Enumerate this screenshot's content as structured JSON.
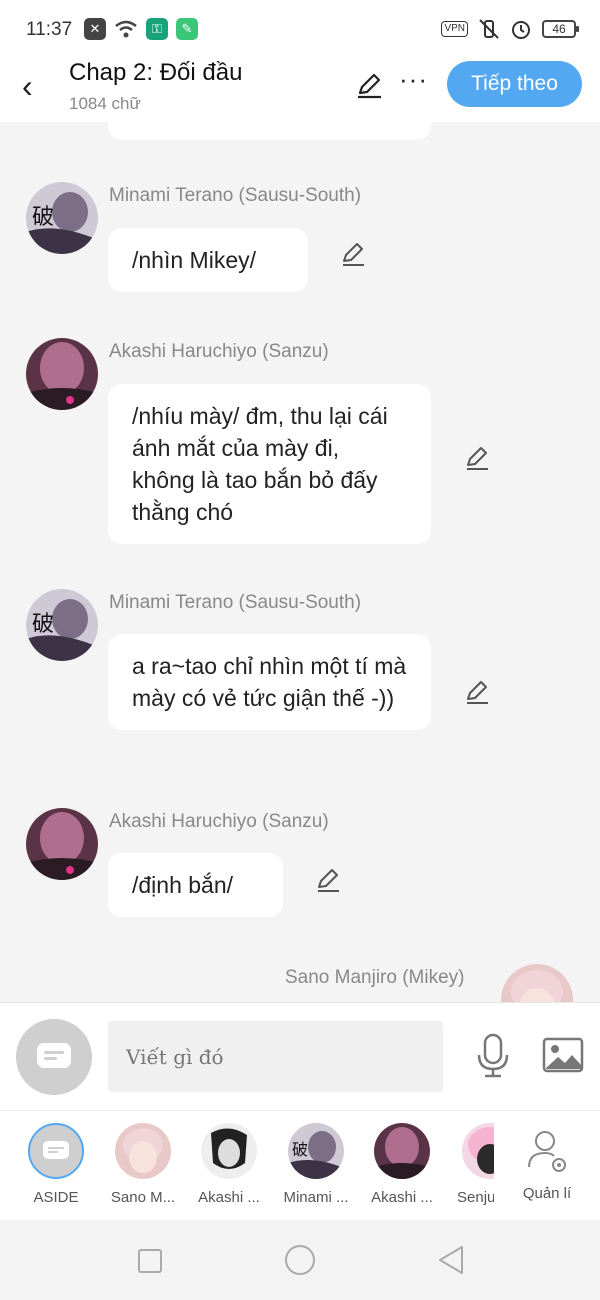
{
  "status": {
    "time": "11:37",
    "vpn": "VPN",
    "battery": "46"
  },
  "header": {
    "title": "Chap 2: Đối đầu",
    "subtitle": "1084 chữ",
    "next_label": "Tiếp theo",
    "more_label": "···",
    "back_label": "‹"
  },
  "messages": [
    {
      "name": "Minami Terano (Sausu-South)",
      "text": "/nhìn Mikey/"
    },
    {
      "name": "Akashi Haruchiyo (Sanzu)",
      "text": "/nhíu mày/ đm, thu lại cái ánh mắt của mày đi, không là tao bắn bỏ đấy thằng chó"
    },
    {
      "name": "Minami Terano (Sausu-South)",
      "text": "a ra~tao chỉ nhìn một tí mà mày có vẻ tức giận thế -))"
    },
    {
      "name": "Akashi Haruchiyo (Sanzu)",
      "text": "/định bắn/"
    },
    {
      "name": "Sano Manjiro (Mikey)"
    }
  ],
  "input": {
    "placeholder": "Viết gì đó"
  },
  "characters": [
    {
      "label": "ASIDE"
    },
    {
      "label": "Sano M..."
    },
    {
      "label": "Akashi ..."
    },
    {
      "label": "Minami ..."
    },
    {
      "label": "Akashi ..."
    },
    {
      "label": "Senju"
    },
    {
      "label": "Quản lí"
    }
  ],
  "colors": {
    "accent": "#53a8f1",
    "bubble": "#ffffff",
    "background": "#f4f4f4"
  }
}
